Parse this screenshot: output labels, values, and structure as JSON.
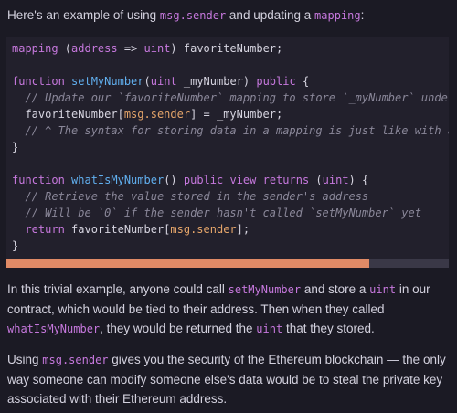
{
  "intro": {
    "text_a": "Here's an example of using ",
    "code_a": "msg.sender",
    "text_b": " and updating a ",
    "code_b": "mapping",
    "text_c": ":"
  },
  "code": {
    "l1": {
      "ident": "mapping",
      "p1": " (",
      "addr": "address",
      "arrow": " => ",
      "uint": "uint",
      "rest": ") favoriteNumber;"
    },
    "l3": {
      "kw": "function",
      "sp": " ",
      "fn": "setMyNumber",
      "p": "(",
      "uint": "uint",
      "arg": " _myNumber) ",
      "pub": "public",
      "end": " {"
    },
    "l4": "  // Update our `favoriteNumber` mapping to store `_myNumber` under `msg.sender`",
    "l5": {
      "a": "  favoriteNumber[",
      "ms": "msg.sender",
      "b": "] = _myNumber;"
    },
    "l6": "  // ^ The syntax for storing data in a mapping is just like with arrays",
    "l7": "}",
    "l9": {
      "kw": "function",
      "sp": " ",
      "fn": "whatIsMyNumber",
      "p": "() ",
      "pub": "public",
      "sp2": " ",
      "view": "view",
      "sp3": " ",
      "ret": "returns",
      "p2": " (",
      "uint": "uint",
      "end": ") {"
    },
    "l10": "  // Retrieve the value stored in the sender's address",
    "l11": "  // Will be `0` if the sender hasn't called `setMyNumber` yet",
    "l12": {
      "ret": "  return",
      "a": " favoriteNumber[",
      "ms": "msg.sender",
      "b": "];"
    },
    "l13": "}"
  },
  "scrollbar": {
    "position_fraction": 0.82
  },
  "para1": {
    "a": "In this trivial example, anyone could call ",
    "c1": "setMyNumber",
    "b": " and store a ",
    "c2": "uint",
    "c": " in our contract, which would be tied to their address. Then when they called ",
    "c3": "whatIsMyNumber",
    "d": ", they would be returned the ",
    "c4": "uint",
    "e": " that they stored."
  },
  "para2": {
    "a": "Using ",
    "c1": "msg.sender",
    "b": " gives you the security of the Ethereum blockchain — the only way someone can modify someone else's data would be to steal the private key associated with their Ethereum address."
  }
}
